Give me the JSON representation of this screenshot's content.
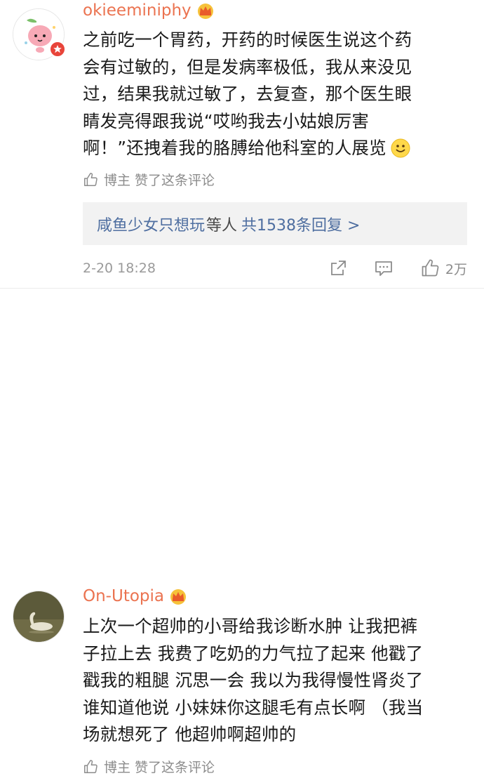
{
  "comments": [
    {
      "username": "okieeminiphy",
      "avatar_icon": "peach-sticker-avatar",
      "badge_icon": "crown-vip-badge",
      "verified_icon": "red-star-badge",
      "text_lines": [
        "之前吃一个胃药，开药的时候医生说这个药",
        "会有过敏的，但是发病率极低，我从来没见",
        "过，结果我就过敏了，去复查，那个医生眼",
        "睛发亮得跟我说“哎哟我去小姑娘厉害",
        "啊！”还拽着我的胳膊给他科室的人展览"
      ],
      "liked_by": "博主 赞了这条评论",
      "reply_summary": {
        "replier": "咸鱼少女只想玩",
        "middle": "等人",
        "count_text": "共1538条回复 >"
      },
      "time": "2-20 18:28",
      "like_count": "2万"
    },
    {
      "username": "On-Utopia",
      "avatar_icon": "swan-photo-avatar",
      "badge_icon": "crown-vip-badge",
      "text_lines": [
        "上次一个超帅的小哥给我诊断水肿 让我把裤",
        "子拉上去 我费了吃奶的力气拉了起来 他戳了",
        "戳我的粗腿 沉思一会 我以为我得慢性肾炎了",
        "谁知道他说 小妹妹你这腿毛有点长啊 （我当",
        "场就想死了 他超帅啊超帅的"
      ],
      "liked_by": "博主 赞了这条评论"
    }
  ],
  "colors": {
    "username": "#eb7350",
    "link": "#4e6ea0",
    "muted": "#8c8c8c",
    "reply_bg": "#f2f2f2"
  }
}
